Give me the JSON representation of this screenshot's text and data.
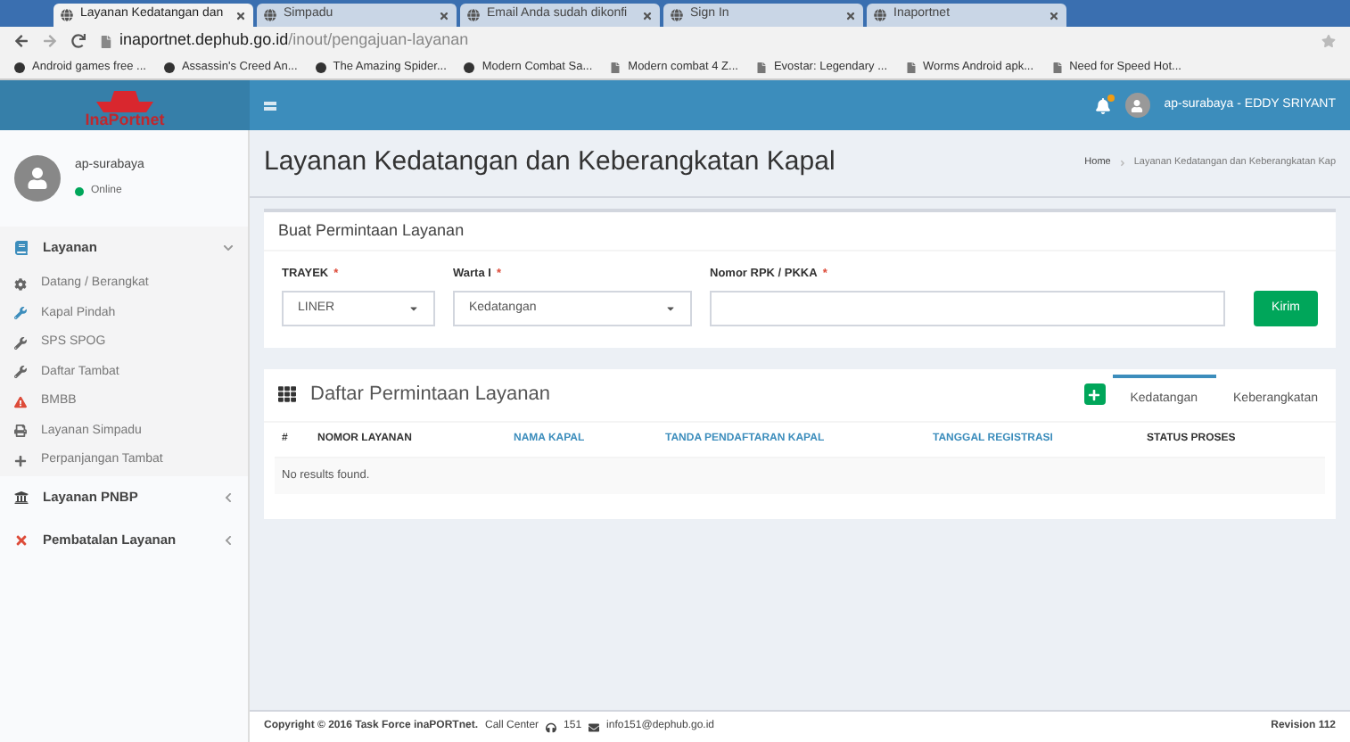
{
  "browser": {
    "tabs": [
      {
        "title": "Layanan Kedatangan dan",
        "selected": true
      },
      {
        "title": "Simpadu",
        "selected": false
      },
      {
        "title": "Email Anda sudah dikonfi",
        "selected": false
      },
      {
        "title": "Sign In",
        "selected": false
      },
      {
        "title": "Inaportnet",
        "selected": false
      }
    ],
    "url": {
      "host": "inaportnet.dephub.go.id",
      "path": "/inout/pengajuan-layanan"
    },
    "bookmarks": [
      {
        "label": "Android games free ...",
        "kind": "site"
      },
      {
        "label": "Assassin's Creed An...",
        "kind": "site"
      },
      {
        "label": "The Amazing Spider...",
        "kind": "site"
      },
      {
        "label": "Modern Combat Sa...",
        "kind": "site"
      },
      {
        "label": "Modern combat 4 Z...",
        "kind": "page"
      },
      {
        "label": "Evostar: Legendary ...",
        "kind": "page"
      },
      {
        "label": "Worms Android apk...",
        "kind": "page"
      },
      {
        "label": "Need for Speed Hot...",
        "kind": "page"
      }
    ]
  },
  "header": {
    "logo": "InaPortnet",
    "notification": true,
    "user": "ap-surabaya - EDDY SRIYANT"
  },
  "sidebar": {
    "user": {
      "name": "ap-surabaya",
      "status": "Online"
    },
    "items": [
      {
        "label": "Layanan",
        "expanded": true,
        "children": [
          {
            "label": "Datang / Berangkat"
          },
          {
            "label": "Kapal Pindah"
          },
          {
            "label": "SPS SPOG"
          },
          {
            "label": "Daftar Tambat"
          },
          {
            "label": "BMBB"
          },
          {
            "label": "Layanan Simpadu"
          },
          {
            "label": "Perpanjangan Tambat"
          }
        ]
      },
      {
        "label": "Layanan PNBP",
        "expanded": false
      },
      {
        "label": "Pembatalan Layanan",
        "expanded": false
      }
    ]
  },
  "page": {
    "title": "Layanan Kedatangan dan Keberangkatan Kapal",
    "breadcrumb": [
      "Home",
      "Layanan Kedatangan dan Keberangkatan Kap"
    ]
  },
  "form": {
    "title": "Buat Permintaan Layanan",
    "fields": [
      {
        "label": "TRAYEK",
        "required_mark": "*",
        "kind": "select",
        "value": "LINER"
      },
      {
        "label": "Warta I",
        "required_mark": "*",
        "kind": "select",
        "value": "Kedatangan"
      },
      {
        "label": "Nomor RPK / PKKA",
        "required_mark": "*",
        "kind": "text"
      }
    ],
    "button": "Kirim"
  },
  "list": {
    "title": "Daftar Permintaan Layanan",
    "tabs": [
      {
        "label": "Kedatangan",
        "selected": true
      },
      {
        "label": "Keberangkatan",
        "selected": false
      }
    ],
    "columns": [
      {
        "label": "#",
        "sortable": false
      },
      {
        "label": "NOMOR LAYANAN",
        "sortable": false
      },
      {
        "label": "NAMA KAPAL",
        "sortable": true
      },
      {
        "label": "TANDA PENDAFTARAN KAPAL",
        "sortable": true
      },
      {
        "label": "TANGGAL REGISTRASI",
        "sortable": true
      },
      {
        "label": "STATUS PROSES",
        "sortable": false
      }
    ],
    "empty": "No results found."
  },
  "footer": {
    "copyright": "Copyright © 2016 Task Force inaPORTnet.",
    "call_center": "Call Center",
    "phone": "151",
    "email": "info151@dephub.go.id",
    "revision": "Revision 112"
  }
}
